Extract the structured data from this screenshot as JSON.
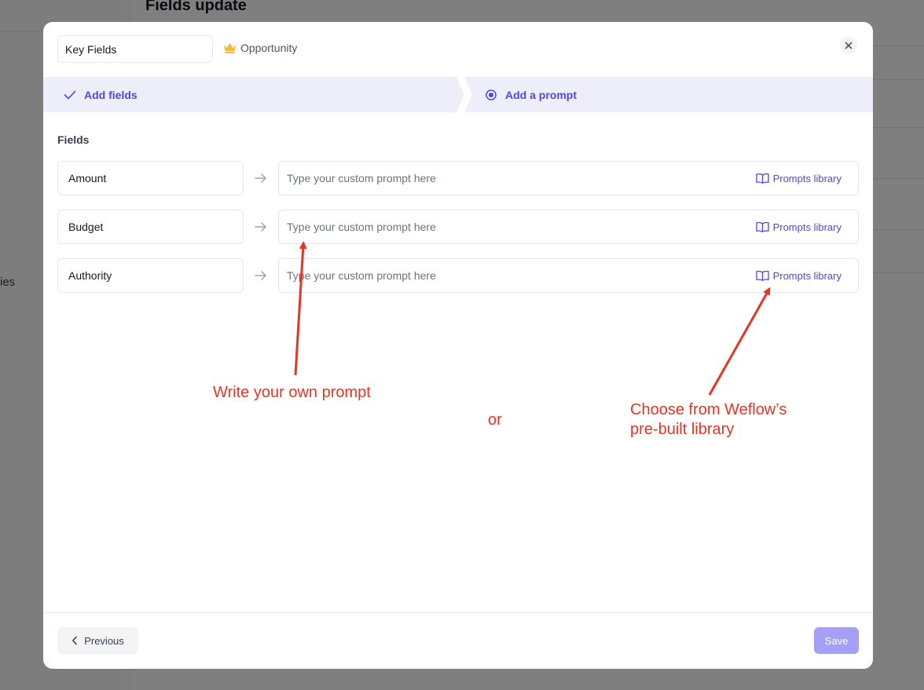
{
  "background": {
    "page_title": "Fields update",
    "sidebar_fragment": "ies"
  },
  "modal": {
    "name_input_value": "Key Fields",
    "object": {
      "icon": "crown-icon",
      "label": "Opportunity"
    },
    "close_icon": "close-icon"
  },
  "stepper": {
    "steps": [
      {
        "label": "Add fields",
        "state": "completed",
        "icon": "check-icon"
      },
      {
        "label": "Add a prompt",
        "state": "current",
        "icon": "radio-dot-icon"
      }
    ]
  },
  "fields_section": {
    "title": "Fields",
    "rows": [
      {
        "field": "Amount",
        "prompt_value": "",
        "prompt_placeholder": "Type your custom prompt here",
        "library_label": "Prompts library"
      },
      {
        "field": "Budget",
        "prompt_value": "",
        "prompt_placeholder": "Type your custom prompt here",
        "library_label": "Prompts library"
      },
      {
        "field": "Authority",
        "prompt_value": "",
        "prompt_placeholder": "Type your custom prompt here",
        "library_label": "Prompts library"
      }
    ]
  },
  "annotations": {
    "left": "Write your own prompt",
    "middle": "or",
    "right_line1": "Choose from Weflow’s",
    "right_line2": "pre-built library",
    "color": "#ea3323"
  },
  "footer": {
    "previous_label": "Previous",
    "save_label": "Save"
  },
  "colors": {
    "accent": "#4f46e5",
    "stepper_bg": "#eeeefb",
    "save_disabled": "#a5a0f5"
  }
}
